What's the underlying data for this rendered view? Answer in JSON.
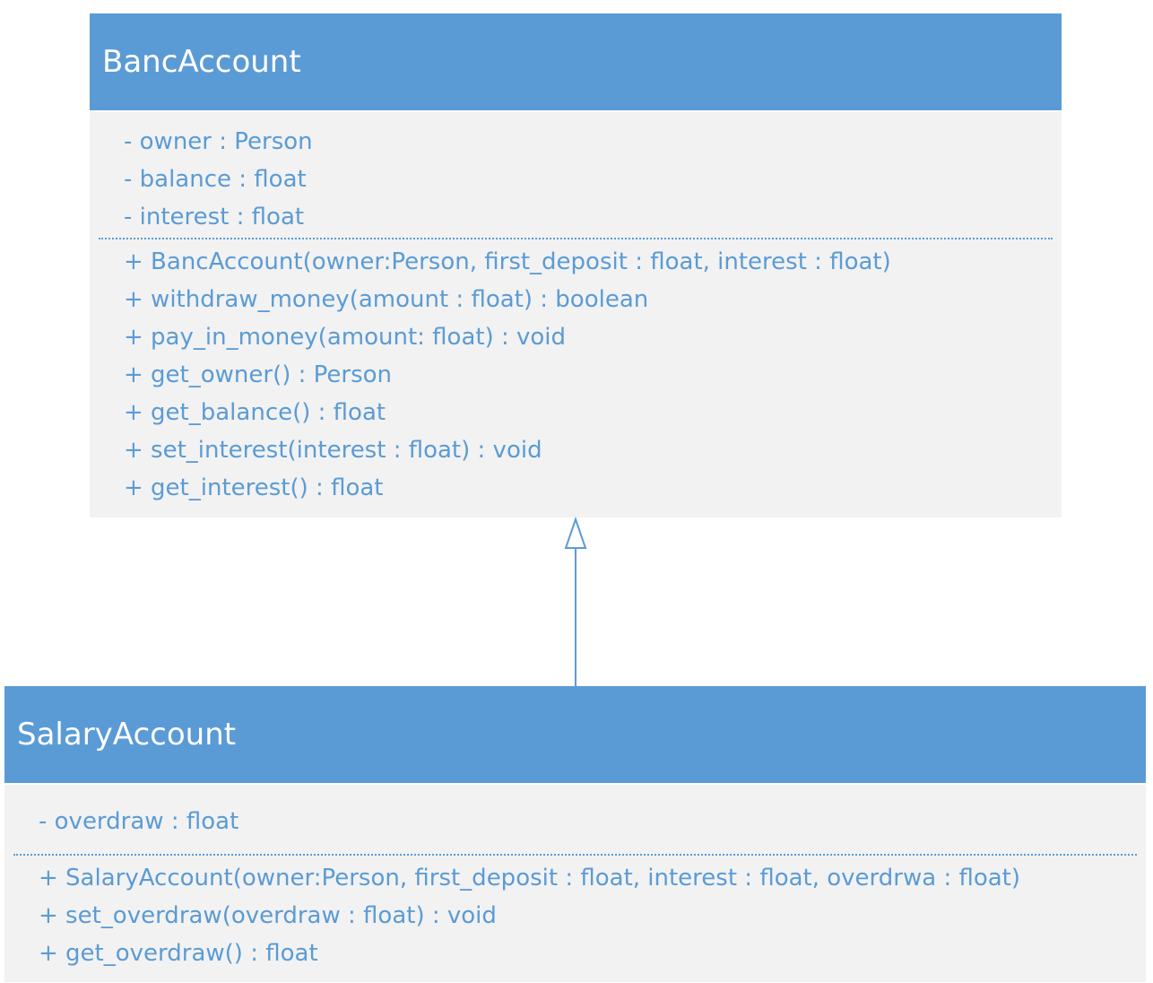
{
  "classes": [
    {
      "name": "BancAccount",
      "attributes": [
        "- owner : Person",
        "- balance : float",
        "- interest : float"
      ],
      "methods": [
        "+ BancAccount(owner:Person, first_deposit : float, interest : float)",
        "+ withdraw_money(amount : float) : boolean",
        "+ pay_in_money(amount: float) : void",
        "+ get_owner() : Person",
        "+ get_balance() : float",
        "+ set_interest(interest : float) : void",
        "+ get_interest() : float"
      ]
    },
    {
      "name": "SalaryAccount",
      "attributes": [
        "- overdraw : float"
      ],
      "methods": [
        "+ SalaryAccount(owner:Person, first_deposit : float, interest : float, overdrwa : float)",
        "+ set_overdraw(overdraw : float) : void",
        "+ get_overdraw() : float"
      ]
    }
  ],
  "relations": [
    {
      "type": "inheritance",
      "from": "SalaryAccount",
      "to": "BancAccount"
    }
  ],
  "colors": {
    "header": "#5b9bd5",
    "body": "#f2f2f2",
    "text": "#5b9bd5",
    "header_text": "#ffffff"
  }
}
